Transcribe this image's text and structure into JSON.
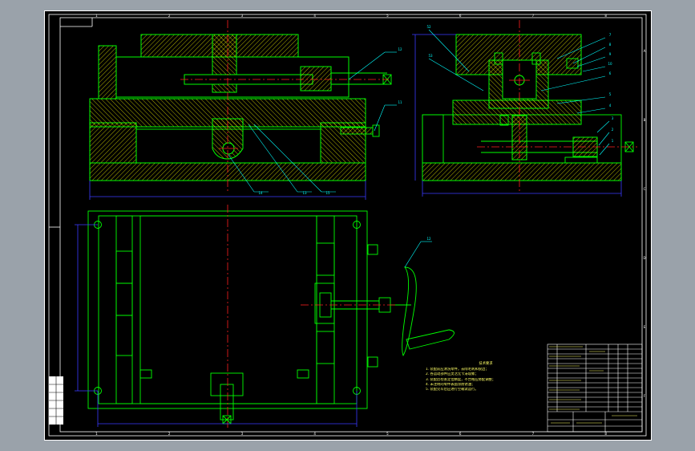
{
  "frame_numbers": {
    "top": [
      "1",
      "2",
      "3",
      "4",
      "5",
      "6",
      "7",
      "8"
    ],
    "bottom": [
      "1",
      "2",
      "3",
      "4",
      "5",
      "6",
      "7",
      "8"
    ],
    "right": [
      "A",
      "B",
      "C",
      "D",
      "E",
      "F"
    ]
  },
  "balloons_front": [
    "12",
    "11",
    "14",
    "13",
    "15"
  ],
  "balloons_side": [
    "52",
    "53",
    "7",
    "8",
    "9",
    "10",
    "6",
    "5",
    "4",
    "3",
    "2",
    "1"
  ],
  "balloon_handwheel": "12",
  "technical_requirements": {
    "title": "技术要求",
    "lines": [
      "1. 装配前应清洗零件，去除毛刺和锐边；",
      "2. 各运动部件应灵活无卡滞现象；",
      "3. 装配后检查定位精度，不合格应修配调整；",
      "4. 未注明的零件表面涂防锈油；",
      "5. 装配完毕后应进行空载试运行。"
    ]
  },
  "colors": {
    "background": "#000000",
    "outline": "#00ff00",
    "centerline": "#ff2020",
    "dimension": "#3a3aff",
    "hatch": "#ffff00",
    "section": "#ff00ff",
    "frame": "#ffffff",
    "leader": "#00ffff"
  }
}
